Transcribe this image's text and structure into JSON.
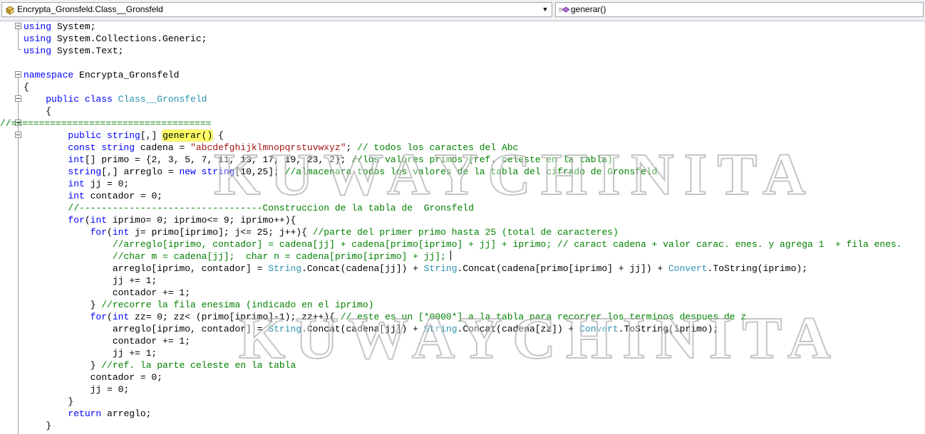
{
  "navigation": {
    "class_selector": {
      "value": "Encrypta_Gronsfeld.Class__Gronsfeld",
      "icon": "class-icon"
    },
    "member_selector": {
      "value": "generar()",
      "icon": "method-icon"
    },
    "dropdown_arrow": "▼"
  },
  "watermark": {
    "text_top": "KUWAYCHINITA",
    "text_bottom": "KUWAYCHINITA"
  },
  "code": {
    "l1": {
      "kw": "using",
      "rest": " System;"
    },
    "l2": {
      "kw": "using",
      "rest": " System.Collections.Generic;"
    },
    "l3": {
      "kw": "using",
      "rest": " System.Text;"
    },
    "l5": {
      "kw": "namespace",
      "rest": " Encrypta_Gronsfeld"
    },
    "l6": "{",
    "l7": {
      "indent": "    ",
      "kw": "public class",
      "type": "Class__Gronsfeld"
    },
    "l8": "    {",
    "l9": "//====================================",
    "l10": {
      "indent": "        ",
      "kw1": "public",
      "kw2": "string",
      "mid": "[,] ",
      "method": "generar()",
      "end": " {"
    },
    "l11": {
      "indent": "        ",
      "kw": "const string",
      "mid": " cadena = ",
      "str": "\"abcdefghijklmnopqrstuvwxyz\"",
      "end": "; ",
      "cm": "// todos los caractes del Abc"
    },
    "l12": {
      "indent": "        ",
      "kw": "int",
      "mid": "[] primo = {2, 3, 5, 7, 11, 13, 17, 19, 23, 2}; ",
      "cm": "//los valores primos (ref. celeste en la tabla)"
    },
    "l13": {
      "indent": "        ",
      "kw": "string",
      "mid": "[,] arreglo = ",
      "kw2": "new",
      "kw3": "string",
      "mid2": "[10,25]; ",
      "cm": "//almacenara todos los valores de la tabla del cifrado de Gronsfeld"
    },
    "l14": {
      "indent": "        ",
      "kw": "int",
      "rest": " jj = 0;"
    },
    "l15": {
      "indent": "        ",
      "kw": "int",
      "rest": " contador = 0;"
    },
    "l16": {
      "indent": "        ",
      "cm": "//---------------------------------Construccion de la tabla de  Gronsfeld"
    },
    "l17": {
      "indent": "        ",
      "kw": "for",
      "mid": "(",
      "kw2": "int",
      "rest": " iprimo= 0; iprimo<= 9; iprimo++){"
    },
    "l18": {
      "indent": "            ",
      "kw": "for",
      "mid": "(",
      "kw2": "int",
      "rest": " j= primo[iprimo]; j<= 25; j++){ ",
      "cm": "//parte del primer primo hasta 25 (total de caracteres)"
    },
    "l19": {
      "indent": "                ",
      "cm": "//arreglo[iprimo, contador] = cadena[jj] + cadena[primo[iprimo] + jj] + iprimo; // caract cadena + valor carac. enes. y agrega 1  + fila enes."
    },
    "l20": {
      "indent": "                ",
      "cm": "//char m = cadena[jj];  char n = cadena[primo[iprimo] + jj];"
    },
    "l21": {
      "indent": "                ",
      "a": "arreglo[iprimo, contador] = ",
      "t1": "String",
      "b": ".Concat(cadena[jj]) + ",
      "t2": "String",
      "c": ".Concat(cadena[primo[iprimo] + jj]) + ",
      "t3": "Convert",
      "d": ".ToString(iprimo);"
    },
    "l22": "                jj += 1;",
    "l23": "                contador += 1;",
    "l24": {
      "indent": "            ",
      "mid": "} ",
      "cm": "//recorre la fila enesima (indicado en el iprimo)"
    },
    "l25": {
      "indent": "            ",
      "kw": "for",
      "mid": "(",
      "kw2": "int",
      "rest": " zz= 0; zz< (primo[iprimo]-1); zz++){ ",
      "cm": "// este es un [*0000*] a la tabla para recorrer los terminos despues de z"
    },
    "l26": {
      "indent": "                ",
      "a": "arreglo[iprimo, contador] = ",
      "t1": "String",
      "b": ".Concat(cadena[jj]) + ",
      "t2": "String",
      "c": ".Concat(cadena[zz]) + ",
      "t3": "Convert",
      "d": ".ToString(iprimo);"
    },
    "l27": "                contador += 1;",
    "l28": "                jj += 1;",
    "l29": {
      "indent": "            ",
      "mid": "} ",
      "cm": "//ref. la parte celeste en la tabla"
    },
    "l30": "            contador = 0;",
    "l31": "            jj = 0;",
    "l32": "        }",
    "l33": {
      "indent": "        ",
      "kw": "return",
      "rest": " arreglo;"
    },
    "l34": "    }"
  },
  "colors": {
    "keyword": "#0000ff",
    "type": "#2b91af",
    "comment": "#008000",
    "string": "#a31515",
    "highlight": "#ffff66"
  }
}
